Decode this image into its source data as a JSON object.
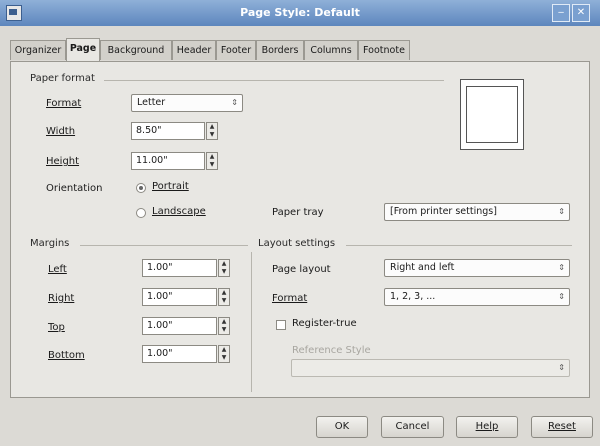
{
  "window": {
    "title": "Page Style: Default"
  },
  "tabs": [
    {
      "label": "Organizer"
    },
    {
      "label": "Page"
    },
    {
      "label": "Background"
    },
    {
      "label": "Header"
    },
    {
      "label": "Footer"
    },
    {
      "label": "Borders"
    },
    {
      "label": "Columns"
    },
    {
      "label": "Footnote"
    }
  ],
  "paper_format": {
    "section_label": "Paper format",
    "format_label": "Format",
    "format_value": "Letter",
    "width_label": "Width",
    "width_value": "8.50\"",
    "height_label": "Height",
    "height_value": "11.00\"",
    "orientation_label": "Orientation",
    "portrait_label": "Portrait",
    "landscape_label": "Landscape",
    "orientation_selected": "Portrait",
    "paper_tray_label": "Paper tray",
    "paper_tray_value": "[From printer settings]"
  },
  "margins": {
    "section_label": "Margins",
    "left_label": "Left",
    "left_value": "1.00\"",
    "right_label": "Right",
    "right_value": "1.00\"",
    "top_label": "Top",
    "top_value": "1.00\"",
    "bottom_label": "Bottom",
    "bottom_value": "1.00\""
  },
  "layout_settings": {
    "section_label": "Layout settings",
    "page_layout_label": "Page layout",
    "page_layout_value": "Right and left",
    "format_label": "Format",
    "format_value": "1, 2, 3, ...",
    "register_true_label": "Register-true",
    "register_true_checked": false,
    "reference_style_label": "Reference Style",
    "reference_style_value": ""
  },
  "buttons": {
    "ok": "OK",
    "cancel": "Cancel",
    "help": "Help",
    "reset": "Reset"
  },
  "colors": {
    "titlebar": "#5d86bd",
    "dialog_bg": "#dcdad5",
    "panel_bg": "#e8e7e3"
  }
}
